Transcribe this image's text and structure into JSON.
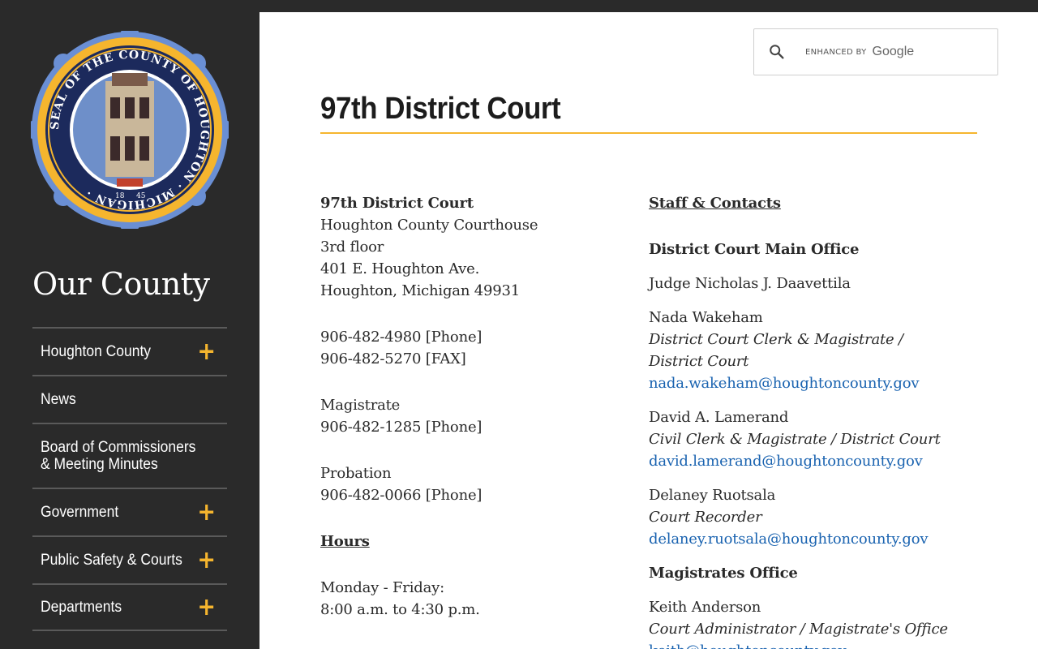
{
  "sidebar": {
    "title": "Our County",
    "seal_alt": "SEAL OF THE COUNTY OF HOUGHTON MICHIGAN 1845",
    "items": [
      {
        "label": "Houghton County",
        "expandable": true
      },
      {
        "label": "News",
        "expandable": false
      },
      {
        "label": "Board of Commissioners & Meeting Minutes",
        "expandable": false
      },
      {
        "label": "Government",
        "expandable": true
      },
      {
        "label": "Public Safety & Courts",
        "expandable": true
      },
      {
        "label": "Departments",
        "expandable": true
      }
    ],
    "plus_glyph": "+"
  },
  "search": {
    "enhanced_by": "ENHANCED BY",
    "brand": "Google",
    "icon": "search-icon"
  },
  "page": {
    "title": "97th District Court"
  },
  "left": {
    "court_name": "97th District Court",
    "address_lines": [
      "Houghton County Courthouse",
      "3rd floor",
      "401 E. Houghton Ave.",
      "Houghton, Michigan 49931"
    ],
    "phone": "906-482-4980 [Phone]",
    "fax": "906-482-5270 [FAX]",
    "magistrate_label": "Magistrate",
    "magistrate_phone": "906-482-1285  [Phone]",
    "probation_label": "Probation",
    "probation_phone": "906-482-0066  [Phone]",
    "hours_heading": "Hours",
    "hours_days": "Monday - Friday:",
    "hours_time": "8:00 a.m. to 4:30 p.m."
  },
  "right": {
    "staff_heading": "Staff & Contacts",
    "main_office_heading": "District Court Main Office",
    "judge": "Judge Nicholas J. Daavettila",
    "staff": [
      {
        "name": "Nada Wakeham",
        "role": "District Court Clerk & Magistrate / District Court",
        "email": "nada.wakeham@houghtoncounty.gov"
      },
      {
        "name": "David A. Lamerand",
        "role": "Civil Clerk & Magistrate / District Court",
        "email": "david.lamerand@houghtoncounty.gov"
      },
      {
        "name": "Delaney Ruotsala",
        "role": "Court Recorder",
        "email": "delaney.ruotsala@houghtoncounty.gov"
      }
    ],
    "magistrates_heading": "Magistrates Office",
    "magistrates": [
      {
        "name": "Keith Anderson",
        "role": "Court Administrator / Magistrate's Office",
        "email": "keith@houghtoncounty.gov"
      }
    ]
  },
  "colors": {
    "sidebar_bg": "#2a2a2a",
    "accent": "#f5b52e",
    "link": "#1a63b0",
    "text": "#2a2a2a"
  }
}
